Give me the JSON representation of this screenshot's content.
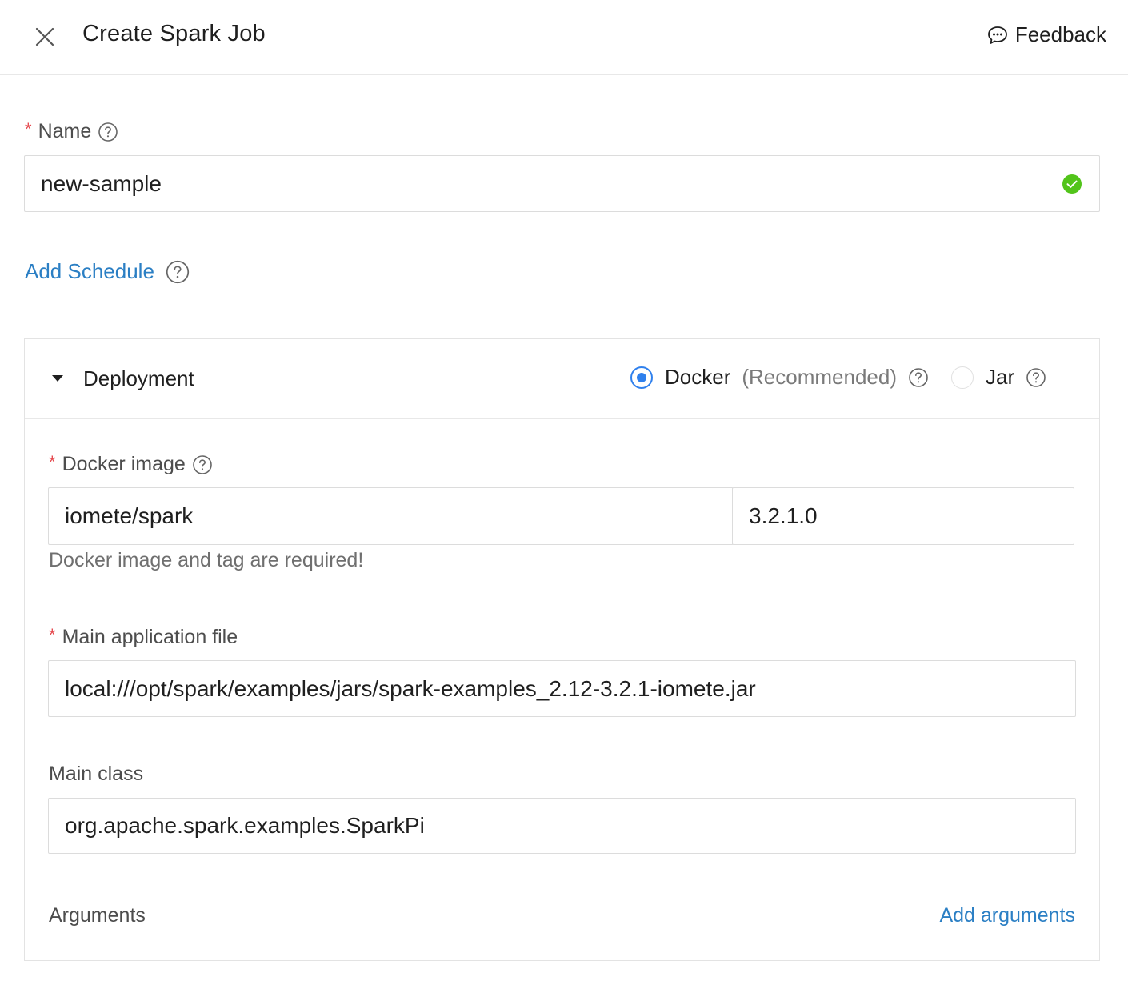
{
  "header": {
    "title": "Create Spark Job",
    "feedback_label": "Feedback"
  },
  "name_field": {
    "label": "Name",
    "value": "new-sample",
    "required": true
  },
  "add_schedule_label": "Add Schedule",
  "deployment": {
    "title": "Deployment",
    "options": [
      {
        "label": "Docker",
        "note": "(Recommended)",
        "selected": true
      },
      {
        "label": "Jar",
        "selected": false
      }
    ],
    "docker_image": {
      "label": "Docker image",
      "image_value": "iomete/spark",
      "tag_value": "3.2.1.0",
      "help": "Docker image and tag are required!"
    },
    "main_application_file": {
      "label": "Main application file",
      "value": "local:///opt/spark/examples/jars/spark-examples_2.12-3.2.1-iomete.jar"
    },
    "main_class": {
      "label": "Main class",
      "value": "org.apache.spark.examples.SparkPi"
    },
    "arguments": {
      "label": "Arguments",
      "add_label": "Add arguments"
    }
  },
  "colors": {
    "link": "#2b7fc4",
    "radio_accent": "#2f80ed",
    "success": "#52c41a",
    "required": "#e5484d"
  }
}
